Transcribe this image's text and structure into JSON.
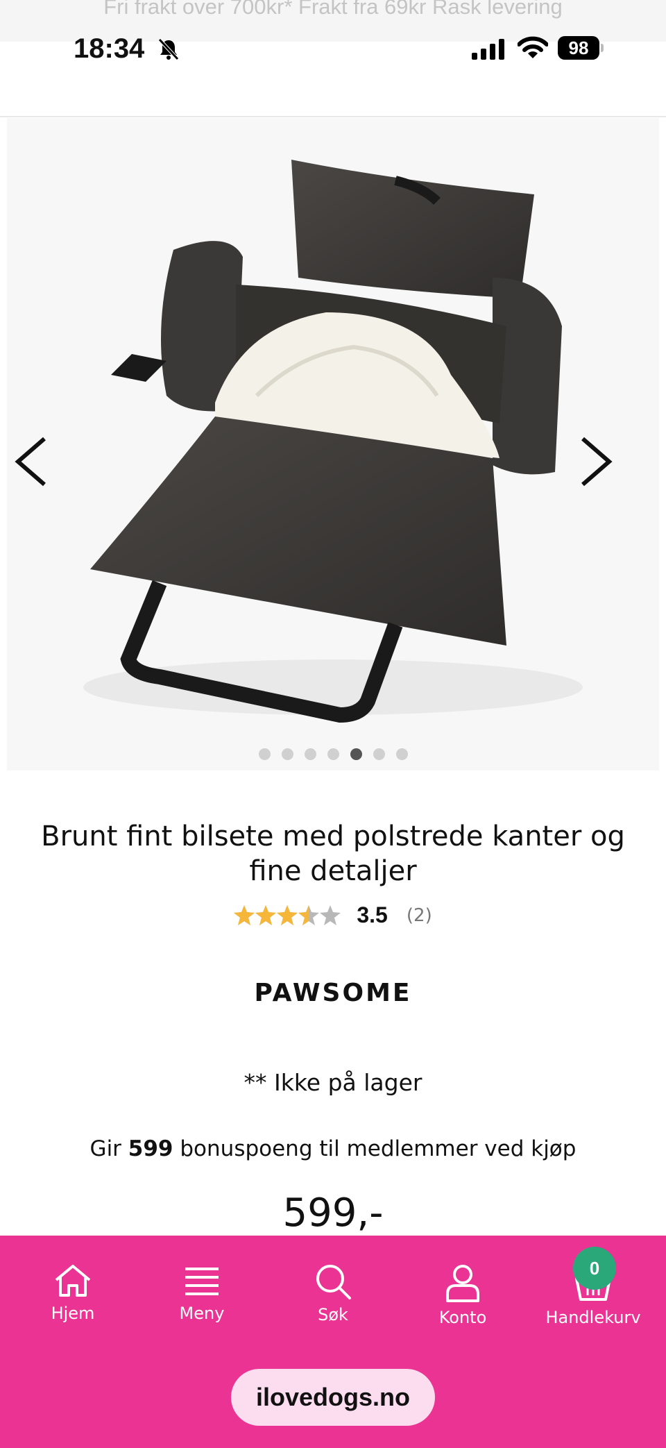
{
  "promo_bar": {
    "text": "Fri frakt over 700kr*  Frakt fra 69kr  Rask levering"
  },
  "status_bar": {
    "time": "18:34",
    "battery": "98"
  },
  "carousel": {
    "total": 7,
    "active_index": 4
  },
  "product": {
    "title": "Brunt fint bilsete med polstrede kanter og fine detaljer",
    "rating_value": "3.5",
    "rating_fraction": 0.7,
    "rating_count": "(2)",
    "brand": "PAWSOME",
    "stock_status": "** Ikke på lager",
    "bonus_prefix": "Gir",
    "bonus_points": "599",
    "bonus_suffix": "bonuspoeng til medlemmer ved kjøp",
    "price": "599,-"
  },
  "bottom_nav": {
    "items": [
      {
        "label": "Hjem",
        "icon": "home-icon"
      },
      {
        "label": "Meny",
        "icon": "menu-icon"
      },
      {
        "label": "Søk",
        "icon": "search-icon"
      },
      {
        "label": "Konto",
        "icon": "account-icon"
      },
      {
        "label": "Handlekurv",
        "icon": "basket-icon"
      }
    ],
    "cart_count": "0"
  },
  "browser": {
    "url": "ilovedogs.no"
  },
  "colors": {
    "brand_pink": "#ea3392",
    "badge_green": "#2aa87a",
    "star_gold": "#f5b63a",
    "url_pill": "#fcdcef"
  }
}
